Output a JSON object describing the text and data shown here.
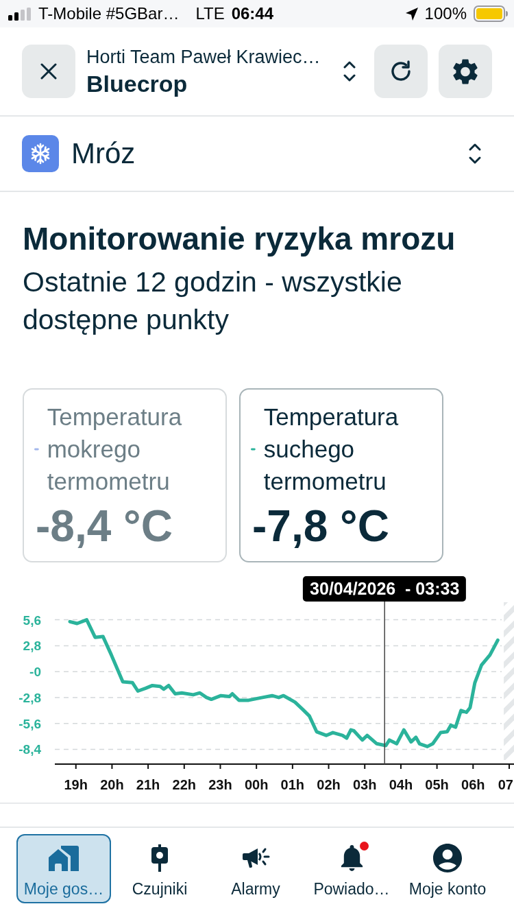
{
  "status_bar": {
    "carrier": "T-Mobile #5GBar…",
    "network": "LTE",
    "time": "06:44",
    "battery": "100%"
  },
  "header": {
    "organization": "Horti Team Paweł Krawiec…",
    "farm": "Bluecrop"
  },
  "selector": {
    "label": "Mróz"
  },
  "title": "Monitorowanie ryzyka mrozu",
  "subtitle": "Ostatnie 12 godzin - wszystkie dostępne punkty",
  "legend": [
    {
      "label": "Temperatura mokrego termometru",
      "value": "-8,4 °C",
      "color": "#a3b7ec",
      "selected": false
    },
    {
      "label": "Temperatura suchego termometru",
      "value": "-7,8 °C",
      "color": "#2bb39b",
      "selected": true
    }
  ],
  "chart": {
    "chart_data": {
      "type": "line",
      "x": [
        "2026-04-29T18:50",
        "2026-04-29T19:02",
        "2026-04-29T19:18",
        "2026-04-29T19:32",
        "2026-04-29T19:45",
        "2026-04-29T19:59",
        "2026-04-29T20:18",
        "2026-04-29T20:34",
        "2026-04-29T20:43",
        "2026-04-29T20:56",
        "2026-04-29T21:07",
        "2026-04-29T21:20",
        "2026-04-29T21:26",
        "2026-04-29T21:34",
        "2026-04-29T21:45",
        "2026-04-29T21:56",
        "2026-04-29T22:15",
        "2026-04-29T22:26",
        "2026-04-29T22:37",
        "2026-04-29T22:45",
        "2026-04-29T23:01",
        "2026-04-29T23:15",
        "2026-04-29T23:20",
        "2026-04-29T23:31",
        "2026-04-29T23:47",
        "2026-04-30T00:10",
        "2026-04-30T00:26",
        "2026-04-30T00:37",
        "2026-04-30T00:45",
        "2026-04-30T01:04",
        "2026-04-30T01:17",
        "2026-04-30T01:28",
        "2026-04-30T01:40",
        "2026-04-30T01:56",
        "2026-04-30T02:07",
        "2026-04-30T02:23",
        "2026-04-30T02:30",
        "2026-04-30T02:37",
        "2026-04-30T02:42",
        "2026-04-30T02:56",
        "2026-04-30T03:04",
        "2026-04-30T03:20",
        "2026-04-30T03:35",
        "2026-04-30T03:41",
        "2026-04-30T03:53",
        "2026-04-30T04:05",
        "2026-04-30T04:17",
        "2026-04-30T04:25",
        "2026-04-30T04:31",
        "2026-04-30T04:44",
        "2026-04-30T04:53",
        "2026-04-30T05:06",
        "2026-04-30T05:17",
        "2026-04-30T05:23",
        "2026-04-30T05:31",
        "2026-04-30T05:40",
        "2026-04-30T05:49",
        "2026-04-30T05:55",
        "2026-04-30T06:03",
        "2026-04-30T06:14",
        "2026-04-30T06:28",
        "2026-04-30T06:41"
      ],
      "series": [
        {
          "color": "#2bb39b",
          "values": [
            5.4,
            5.2,
            5.6,
            3.7,
            3.8,
            1.8,
            -1.1,
            -1.2,
            -2.1,
            -1.8,
            -1.5,
            -1.6,
            -1.9,
            -1.5,
            -2.4,
            -2.3,
            -2.5,
            -2.3,
            -2.8,
            -3.0,
            -2.6,
            -2.7,
            -2.4,
            -3.1,
            -3.1,
            -2.8,
            -2.6,
            -2.8,
            -2.6,
            -3.3,
            -4.1,
            -4.8,
            -6.5,
            -6.9,
            -6.6,
            -6.9,
            -7.2,
            -6.3,
            -6.4,
            -7.4,
            -6.9,
            -7.8,
            -8.0,
            -7.4,
            -7.8,
            -6.3,
            -7.6,
            -7.1,
            -7.8,
            -8.1,
            -7.8,
            -6.6,
            -6.5,
            -5.8,
            -6.0,
            -4.2,
            -4.4,
            -3.9,
            -1.2,
            0.7,
            1.8,
            3.4
          ]
        }
      ],
      "xlim": [
        "2026-04-29T18:25",
        "2026-04-30T07:08"
      ],
      "ylim": [
        -10,
        7.5
      ],
      "xticks": [
        {
          "value": "2026-04-29T19:00",
          "label": "19h"
        },
        {
          "value": "2026-04-29T20:00",
          "label": "20h"
        },
        {
          "value": "2026-04-29T21:00",
          "label": "21h"
        },
        {
          "value": "2026-04-29T22:00",
          "label": "22h"
        },
        {
          "value": "2026-04-29T23:00",
          "label": "23h"
        },
        {
          "value": "2026-04-30T00:00",
          "label": "00h"
        },
        {
          "value": "2026-04-30T01:00",
          "label": "01h"
        },
        {
          "value": "2026-04-30T02:00",
          "label": "02h"
        },
        {
          "value": "2026-04-30T03:00",
          "label": "03h"
        },
        {
          "value": "2026-04-30T04:00",
          "label": "04h"
        },
        {
          "value": "2026-04-30T05:00",
          "label": "05h"
        },
        {
          "value": "2026-04-30T06:00",
          "label": "06h"
        },
        {
          "value": "2026-04-30T07:00",
          "label": "07"
        }
      ],
      "yticks": [
        {
          "value": 5.6,
          "label": "5,6"
        },
        {
          "value": 2.8,
          "label": "2,8"
        },
        {
          "value": 0,
          "label": "-0"
        },
        {
          "value": -2.8,
          "label": "-2,8"
        },
        {
          "value": -5.6,
          "label": "-5,6"
        },
        {
          "value": -8.4,
          "label": "-8,4"
        }
      ],
      "grid": true,
      "ref_lines": [
        {
          "axis": "x",
          "value": "2026-04-30T03:33"
        }
      ],
      "bands": [
        {
          "axis": "x",
          "from": "2026-04-30T06:51",
          "to": "2026-04-30T07:08"
        }
      ],
      "annotations": [
        "30/04/2026  - 03:33"
      ]
    }
  },
  "nav": {
    "items": [
      {
        "label": "Moje gos…",
        "kind": "home",
        "selected": true,
        "dot": false
      },
      {
        "label": "Czujniki",
        "kind": "sensor",
        "selected": false,
        "dot": false
      },
      {
        "label": "Alarmy",
        "kind": "megaphone",
        "selected": false,
        "dot": false
      },
      {
        "label": "Powiado…",
        "kind": "bell",
        "selected": false,
        "dot": true
      },
      {
        "label": "Moje konto",
        "kind": "account",
        "selected": false,
        "dot": false
      }
    ]
  }
}
